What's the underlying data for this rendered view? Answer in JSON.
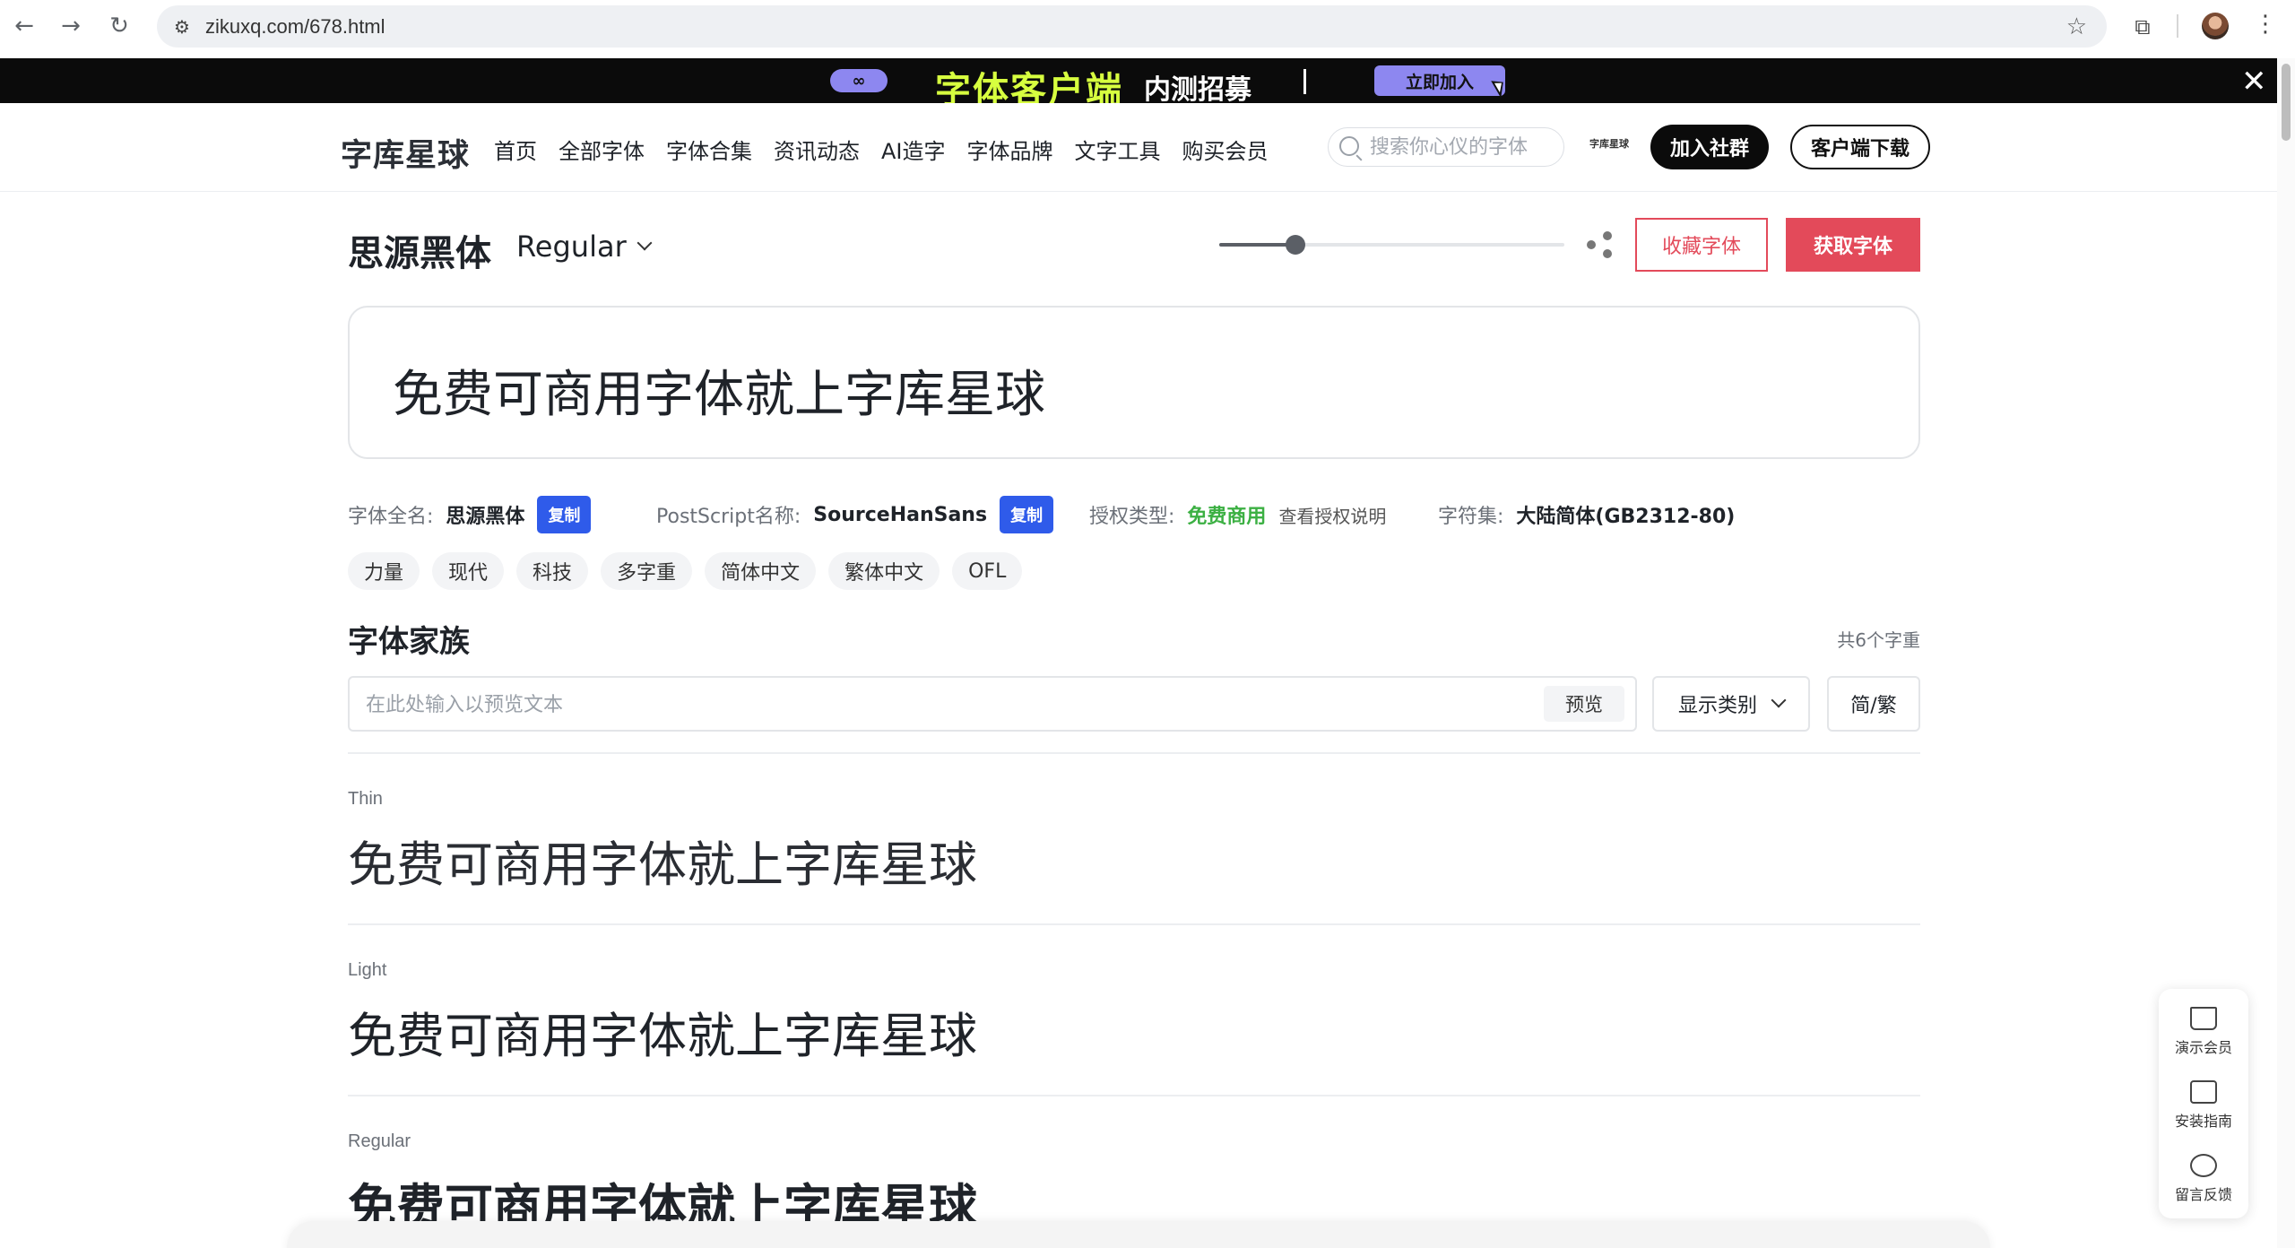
{
  "browser": {
    "url": "zikuxq.com/678.html",
    "back_icon": "arrow-left",
    "forward_icon": "arrow-right",
    "reload_icon": "reload",
    "star_icon": "star",
    "extension_icon": "puzzle",
    "menu_icon": "vertical-dots"
  },
  "promo": {
    "headline": "字体客户端",
    "subline": "内测招募",
    "join_label": "立即加入",
    "close_label": "✕",
    "accent": "#d7ff3f",
    "button_color": "#8d87f0"
  },
  "header": {
    "logo": "字库星球",
    "nav": [
      "首页",
      "全部字体",
      "字体合集",
      "资讯动态",
      "AI造字",
      "字体品牌",
      "文字工具",
      "购买会员"
    ],
    "search_placeholder": "搜索你心仪的字体",
    "brand_mini": "字库星球",
    "join_community": "加入社群",
    "client_download": "客户端下载"
  },
  "font": {
    "title": "思源黑体",
    "weight": "Regular",
    "size_slider_fraction": 0.22,
    "favorite_label": "收藏字体",
    "get_label": "获取字体",
    "preview_text": "免费可商用字体就上字库星球",
    "brand_color": "#e34a5a"
  },
  "info": {
    "fullname_key": "字体全名:",
    "fullname_value": "思源黑体",
    "postscript_key": "PostScript名称:",
    "postscript_value": "SourceHanSans",
    "copy_label": "复制",
    "license_key": "授权类型:",
    "license_value": "免费商用",
    "license_link": "查看授权说明",
    "charset_key": "字符集:",
    "charset_value": "大陆简体(GB2312-80)"
  },
  "tags": [
    "力量",
    "现代",
    "科技",
    "多字重",
    "简体中文",
    "繁体中文",
    "OFL"
  ],
  "family": {
    "title": "字体家族",
    "count": "共6个字重",
    "input_placeholder": "在此处输入以预览文本",
    "preview_button": "预览",
    "display_category": "显示类别",
    "jianfan": "简/繁",
    "weights": [
      {
        "label": "Thin",
        "sample": "免费可商用字体就上字库星球"
      },
      {
        "label": "Light",
        "sample": "免费可商用字体就上字库星球"
      },
      {
        "label": "Regular",
        "sample": "免费可商用字体就上字库星球"
      }
    ]
  },
  "side_panel": {
    "items": [
      {
        "label": "演示会员",
        "icon": "crown-icon"
      },
      {
        "label": "安装指南",
        "icon": "bookmark-icon"
      },
      {
        "label": "留言反馈",
        "icon": "chat-bubble-icon"
      }
    ]
  }
}
